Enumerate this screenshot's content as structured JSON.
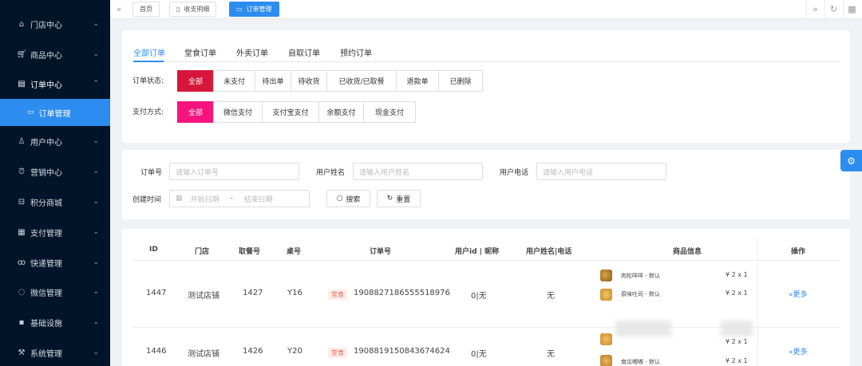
{
  "sidebar": {
    "items": [
      {
        "label": "门店中心",
        "icon": "home-icon"
      },
      {
        "label": "商品中心",
        "icon": "cart-icon"
      },
      {
        "label": "订单中心",
        "icon": "clipboard-icon"
      },
      {
        "label": "用户中心",
        "icon": "user-icon"
      },
      {
        "label": "营销中心",
        "icon": "alarm-icon"
      },
      {
        "label": "积分商城",
        "icon": "store-icon"
      },
      {
        "label": "支付管理",
        "icon": "calculator-icon"
      },
      {
        "label": "快递管理",
        "icon": "bike-icon"
      },
      {
        "label": "微信管理",
        "icon": "chat-icon"
      },
      {
        "label": "基础设施",
        "icon": "grid-icon"
      },
      {
        "label": "系统管理",
        "icon": "hammer-icon"
      }
    ],
    "sub_item": "订单管理"
  },
  "topbar": {
    "tags": [
      "首页",
      "收支明细",
      "订单管理"
    ]
  },
  "filter": {
    "tabs": [
      "全部订单",
      "堂食订单",
      "外卖订单",
      "自取订单",
      "预约订单"
    ],
    "status_label": "订单状态:",
    "status_options": [
      "全部",
      "未支付",
      "待出单",
      "待收货",
      "已收货/已取餐",
      "退款单",
      "已删除"
    ],
    "pay_label": "支付方式:",
    "pay_options": [
      "全部",
      "微信支付",
      "支付宝支付",
      "余额支付",
      "现金支付"
    ]
  },
  "search": {
    "order_no_label": "订单号",
    "order_no_placeholder": "请输入订单号",
    "user_name_label": "用户姓名",
    "user_name_placeholder": "请输入用户姓名",
    "user_phone_label": "用户电话",
    "user_phone_placeholder": "请输入用户电话",
    "created_label": "创建时间",
    "start_placeholder": "开始日期",
    "range_sep": "-",
    "end_placeholder": "结束日期",
    "search_button": "搜索",
    "reset_button": "重置"
  },
  "table": {
    "headers": [
      "ID",
      "门店",
      "取餐号",
      "桌号",
      "订单号",
      "用户id | 昵称",
      "用户姓名|电话",
      "商品信息",
      "操作"
    ],
    "rows": [
      {
        "id": "1447",
        "store": "测试店铺",
        "pickup": "1427",
        "table": "Y16",
        "badge": "堂食",
        "order_no": "1908827186555518976",
        "user": "0|无",
        "name_phone": "无",
        "products": [
          {
            "name": "肉松咩咩 - 默认",
            "qty": "¥ 2 x 1"
          },
          {
            "name": "原味吐司 - 默认",
            "qty": "¥ 2 x 1"
          }
        ],
        "action": "更多"
      },
      {
        "id": "1446",
        "store": "测试店铺",
        "pickup": "1426",
        "table": "Y20",
        "badge": "堂食",
        "order_no": "1908819150843674624",
        "user": "0|无",
        "name_phone": "无",
        "products": [
          {
            "name": "",
            "qty": "¥ 2 x 1"
          },
          {
            "name": "南瓜嘟嘟 - 默认",
            "qty": "¥ 2 x 1"
          }
        ],
        "action": "更多"
      }
    ]
  }
}
